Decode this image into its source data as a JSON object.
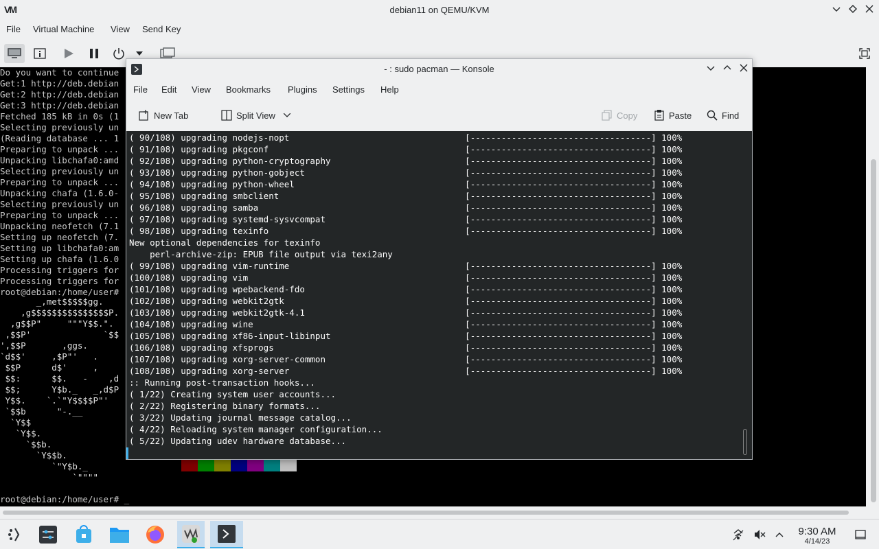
{
  "window": {
    "title": "debian11 on QEMU/KVM",
    "logo": "VM"
  },
  "vm_menu": [
    "File",
    "Virtual Machine",
    "View",
    "Send Key"
  ],
  "guest": {
    "background_lines": [
      "Do you want to continue",
      "Get:1 http://deb.debian",
      "Get:2 http://deb.debian",
      "Get:3 http://deb.debian",
      "Fetched 185 kB in 0s (1",
      "Selecting previously un",
      "(Reading database ... 1",
      "Preparing to unpack ...",
      "Unpacking libchafa0:amd",
      "Selecting previously un",
      "Preparing to unpack ...",
      "Unpacking chafa (1.6.0-",
      "Selecting previously un",
      "Preparing to unpack ...",
      "Unpacking neofetch (7.1",
      "Setting up neofetch (7.",
      "Setting up libchafa0:am",
      "Setting up chafa (1.6.0",
      "Processing triggers for",
      "Processing triggers for",
      "root@debian:/home/user#"
    ],
    "neofetch_art": "       _,met$$$$$gg.\n    ,g$$$$$$$$$$$$$$$P.\n  ,g$$P\"     \"\"\"Y$$.\".\n ,$$P'              `$$\n',$$P       ,ggs.\n`d$$'     ,$P\"'   .\n $$P      d$'     ,\n $$:      $$.   -    ,d\n $$;      Y$b._   _,d$P\n Y$$.    `.`\"Y$$$$P\"'\n `$$b      \"-.__\n  `Y$$\n   `Y$$.\n     `$$b.\n       `Y$$b.\n          `\"Y$b._\n              `\"\"\"\"",
    "prompt": "root@debian:/home/user# _",
    "color_blocks": [
      "#800000",
      "#008000",
      "#808000",
      "#000080",
      "#800080",
      "#008080",
      "#c0c0c0"
    ]
  },
  "konsole": {
    "title": "- : sudo pacman — Konsole",
    "menu": [
      "File",
      "Edit",
      "View",
      "Bookmarks",
      "Plugins",
      "Settings",
      "Help"
    ],
    "toolbar": {
      "new_tab": "New Tab",
      "split_view": "Split View",
      "copy": "Copy",
      "paste": "Paste",
      "find": "Find"
    },
    "lines": [
      "( 90/108) upgrading nodejs-nopt                                  [-----------------------------------] 100%",
      "( 91/108) upgrading pkgconf                                      [-----------------------------------] 100%",
      "( 92/108) upgrading python-cryptography                          [-----------------------------------] 100%",
      "( 93/108) upgrading python-gobject                               [-----------------------------------] 100%",
      "( 94/108) upgrading python-wheel                                 [-----------------------------------] 100%",
      "( 95/108) upgrading smbclient                                    [-----------------------------------] 100%",
      "( 96/108) upgrading samba                                        [-----------------------------------] 100%",
      "( 97/108) upgrading systemd-sysvcompat                           [-----------------------------------] 100%",
      "( 98/108) upgrading texinfo                                      [-----------------------------------] 100%",
      "New optional dependencies for texinfo",
      "    perl-archive-zip: EPUB file output via texi2any",
      "( 99/108) upgrading vim-runtime                                  [-----------------------------------] 100%",
      "(100/108) upgrading vim                                          [-----------------------------------] 100%",
      "(101/108) upgrading wpebackend-fdo                               [-----------------------------------] 100%",
      "(102/108) upgrading webkit2gtk                                   [-----------------------------------] 100%",
      "(103/108) upgrading webkit2gtk-4.1                               [-----------------------------------] 100%",
      "(104/108) upgrading wine                                         [-----------------------------------] 100%",
      "(105/108) upgrading xf86-input-libinput                          [-----------------------------------] 100%",
      "(106/108) upgrading xfsprogs                                     [-----------------------------------] 100%",
      "(107/108) upgrading xorg-server-common                           [-----------------------------------] 100%",
      "(108/108) upgrading xorg-server                                  [-----------------------------------] 100%",
      ":: Running post-transaction hooks...",
      "( 1/22) Creating system user accounts...",
      "( 2/22) Registering binary formats...",
      "( 3/22) Updating journal message catalog...",
      "( 4/22) Reloading system manager configuration...",
      "( 5/22) Updating udev hardware database..."
    ]
  },
  "clock": {
    "time": "9:30 AM",
    "date": "4/14/23"
  },
  "colors": {
    "accent": "#3daee9",
    "terminal_bg": "#232627",
    "panel_bg": "#eff0f1"
  }
}
